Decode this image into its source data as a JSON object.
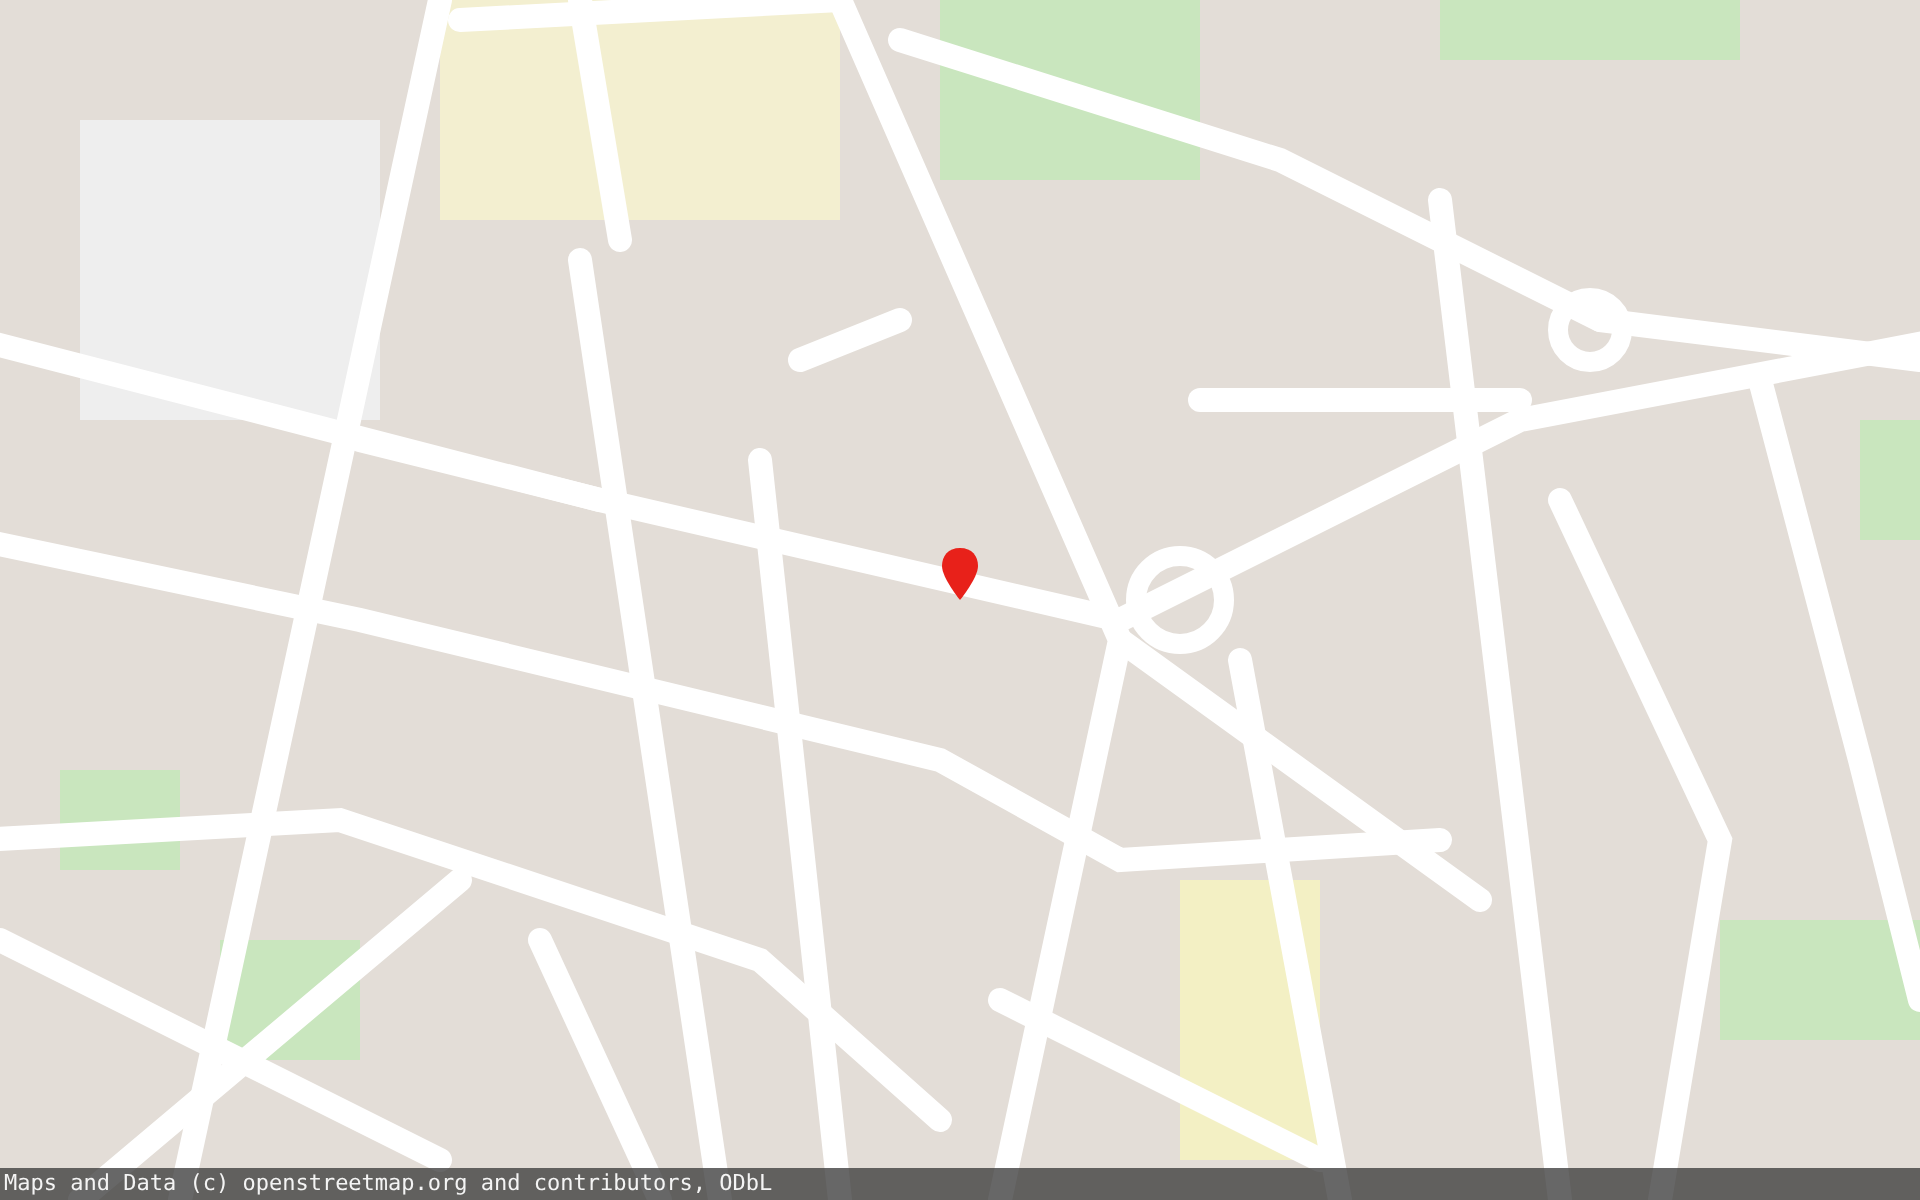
{
  "map": {
    "marker": {
      "shown": true
    }
  },
  "attribution": {
    "text": "Maps and Data (c) openstreetmap.org and contributors, ODbL"
  }
}
